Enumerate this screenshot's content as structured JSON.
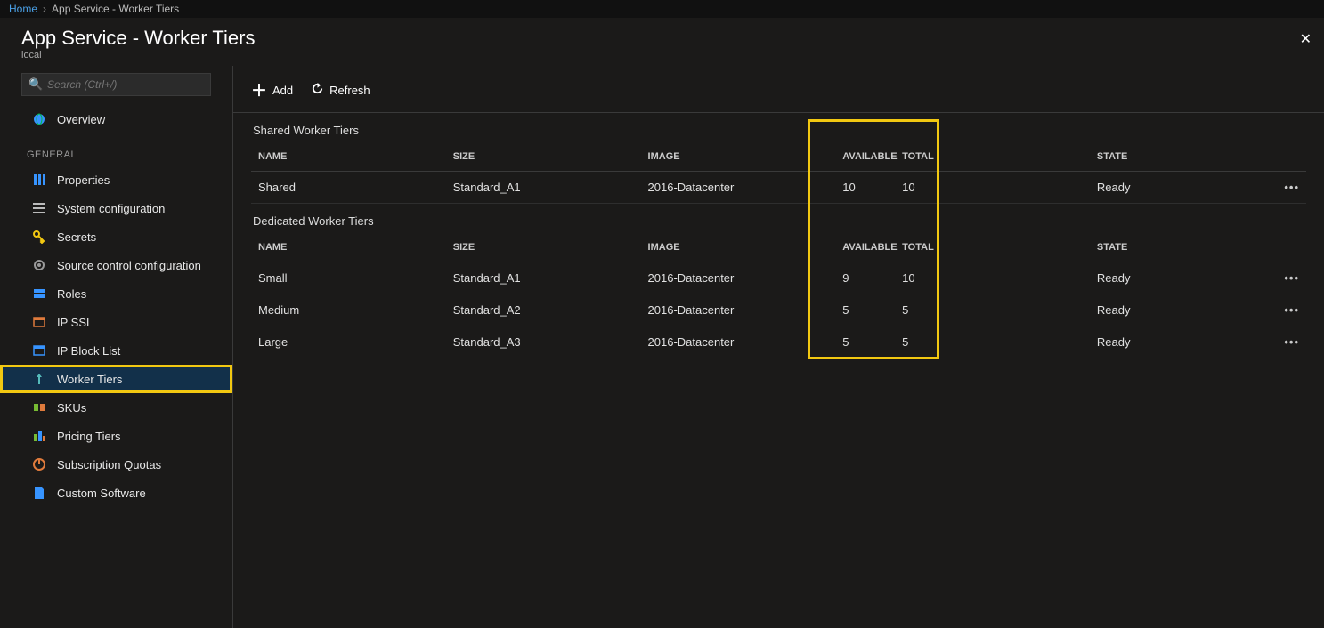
{
  "breadcrumb": {
    "home": "Home",
    "current": "App Service - Worker Tiers"
  },
  "header": {
    "title": "App Service - Worker Tiers",
    "subtitle": "local"
  },
  "search": {
    "placeholder": "Search (Ctrl+/)"
  },
  "sidebar": {
    "overview": "Overview",
    "section_general": "GENERAL",
    "items": {
      "properties": "Properties",
      "system_configuration": "System configuration",
      "secrets": "Secrets",
      "source_control": "Source control configuration",
      "roles": "Roles",
      "ip_ssl": "IP SSL",
      "ip_block_list": "IP Block List",
      "worker_tiers": "Worker Tiers",
      "skus": "SKUs",
      "pricing_tiers": "Pricing Tiers",
      "subscription_quotas": "Subscription Quotas",
      "custom_software": "Custom Software"
    }
  },
  "toolbar": {
    "add": "Add",
    "refresh": "Refresh"
  },
  "columns": {
    "name": "NAME",
    "size": "SIZE",
    "image": "IMAGE",
    "available": "AVAILABLE",
    "total": "TOTAL",
    "state": "STATE"
  },
  "sections": {
    "shared": {
      "title": "Shared Worker Tiers",
      "rows": [
        {
          "name": "Shared",
          "size": "Standard_A1",
          "image": "2016-Datacenter",
          "available": "10",
          "total": "10",
          "state": "Ready"
        }
      ]
    },
    "dedicated": {
      "title": "Dedicated Worker Tiers",
      "rows": [
        {
          "name": "Small",
          "size": "Standard_A1",
          "image": "2016-Datacenter",
          "available": "9",
          "total": "10",
          "state": "Ready"
        },
        {
          "name": "Medium",
          "size": "Standard_A2",
          "image": "2016-Datacenter",
          "available": "5",
          "total": "5",
          "state": "Ready"
        },
        {
          "name": "Large",
          "size": "Standard_A3",
          "image": "2016-Datacenter",
          "available": "5",
          "total": "5",
          "state": "Ready"
        }
      ]
    }
  }
}
